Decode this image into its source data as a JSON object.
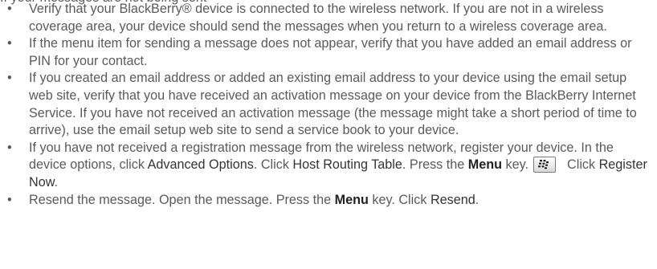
{
  "header_fragment": "If your messages are not being sent",
  "bullets": [
    {
      "text": "Verify that your BlackBerry® device is connected to the wireless network.  If you are not in a wireless coverage area, your device should send the messages when you return to a wireless coverage area."
    },
    {
      "text": "If the menu item for sending a message does not appear, verify that you have added an email address or PIN for your contact."
    },
    {
      "text": "If you created an email address or added an existing email address to your device using the email setup web site, verify that you have received an activation message on your device from the BlackBerry Internet Service. If you have not received an activation message (the message might take a short period of time to arrive), use the email setup web site to send a service book to your device."
    },
    {
      "part1": "If you have not received a registration message from the wireless network, register your device. In the device options, click ",
      "term1": "Advanced Options",
      "part2": ". Click ",
      "term2": "Host Routing Table",
      "part3": ". Press the ",
      "key": "Menu",
      "part4": " key.",
      "part5": "Click ",
      "term3": "Register Now",
      "part6": "."
    },
    {
      "part1": "Resend the message. Open the message. Press the ",
      "key": "Menu",
      "part2": " key. Click ",
      "term1": "Resend",
      "part3": "."
    }
  ],
  "icons": {
    "menu_key": "blackberry-menu-key-icon"
  }
}
